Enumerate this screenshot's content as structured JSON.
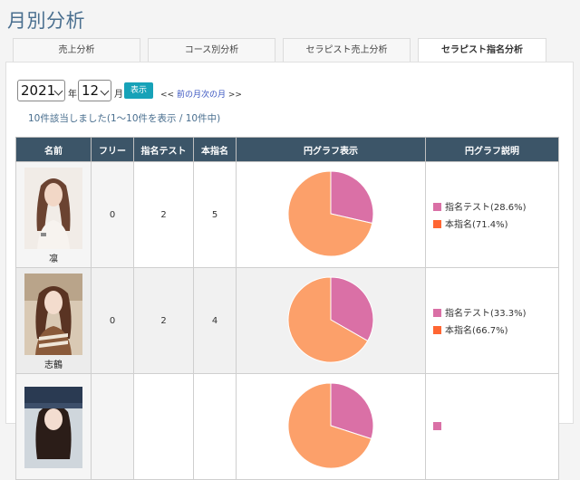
{
  "page_title": "月別分析",
  "tabs": [
    {
      "label": "売上分析",
      "active": false
    },
    {
      "label": "コース別分析",
      "active": false
    },
    {
      "label": "セラピスト売上分析",
      "active": false
    },
    {
      "label": "セラピスト指名分析",
      "active": true
    }
  ],
  "filter": {
    "year": "2021",
    "year_unit": "年",
    "month": "12",
    "month_unit": "月",
    "show_label": "表示",
    "prev_prefix": "<<",
    "prev_label": "前の月",
    "next_label": "次の月",
    "next_suffix": ">>"
  },
  "result_text": "10件該当しました(1～10件を表示 / 10件中)",
  "colors": {
    "header_bg": "#3c5568",
    "accent": "#17a2b8",
    "pie_nomination_test": "#da70a6",
    "pie_nomination": "#fca06a",
    "legend_nomination": "#ff6633"
  },
  "table": {
    "headers": {
      "name": "名前",
      "free": "フリー",
      "nomination_test": "指名テスト",
      "nomination": "本指名",
      "pie": "円グラフ表示",
      "pie_desc": "円グラフ説明"
    },
    "rows": [
      {
        "name": "凛",
        "free": "0",
        "nomination_test": "2",
        "nomination": "5",
        "legend_test": "指名テスト(28.6%)",
        "legend_nomination": "本指名(71.4%)"
      },
      {
        "name": "志鶴",
        "free": "0",
        "nomination_test": "2",
        "nomination": "4",
        "legend_test": "指名テスト(33.3%)",
        "legend_nomination": "本指名(66.7%)"
      },
      {
        "name": "",
        "free": "",
        "nomination_test": "",
        "nomination": "",
        "legend_test": "",
        "legend_nomination": ""
      }
    ]
  },
  "chart_data": [
    {
      "type": "pie",
      "title": "",
      "categories": [
        "指名テスト",
        "本指名"
      ],
      "values": [
        28.6,
        71.4
      ]
    },
    {
      "type": "pie",
      "title": "",
      "categories": [
        "指名テスト",
        "本指名"
      ],
      "values": [
        33.3,
        66.7
      ]
    },
    {
      "type": "pie",
      "title": "",
      "categories": [
        "指名テスト",
        "本指名"
      ],
      "values": [
        30.0,
        70.0
      ]
    }
  ]
}
